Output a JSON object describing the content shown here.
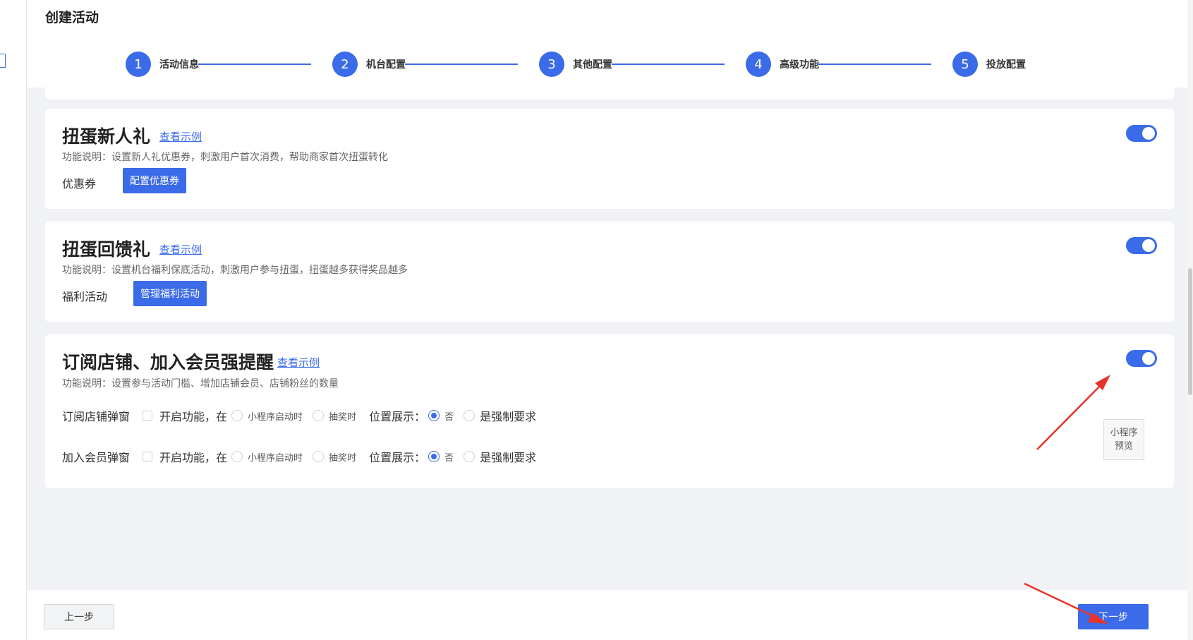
{
  "rail": {
    "icon_glyph": "≡"
  },
  "header": {
    "title": "创建活动"
  },
  "steps": [
    {
      "number": "1",
      "label": "活动信息"
    },
    {
      "number": "2",
      "label": "机台配置"
    },
    {
      "number": "3",
      "label": "其他配置"
    },
    {
      "number": "4",
      "label": "高级功能"
    },
    {
      "number": "5",
      "label": "投放配置"
    }
  ],
  "cards": {
    "newcomer": {
      "title": "扭蛋新人礼",
      "example_link": "查看示例",
      "description": "功能说明：设置新人礼优惠券，刺激用户首次消费，帮助商家首次扭蛋转化",
      "row_label": "优惠券",
      "button": "配置优惠券",
      "enabled": true
    },
    "feedback": {
      "title": "扭蛋回馈礼",
      "example_link": "查看示例",
      "description": "功能说明：设置机台福利保底活动，刺激用户参与扭蛋，扭蛋越多获得奖品越多",
      "row_label": "福利活动",
      "button": "管理福利活动",
      "enabled": true
    },
    "subscribe": {
      "title": "订阅店铺、加入会员强提醒",
      "example_link": "查看示例",
      "description": "功能说明：设置参与活动门槛、增加店铺会员、店铺粉丝的数量",
      "enabled": true,
      "rows": [
        {
          "label": "订阅店铺弹窗",
          "enable_text": "开启功能，在",
          "opt_launch": "小程序启动时",
          "opt_draw": "抽奖时",
          "position_label": "位置展示：",
          "opt_no": "否",
          "opt_force": "是强制要求",
          "selected": "否"
        },
        {
          "label": "加入会员弹窗",
          "enable_text": "开启功能，在",
          "opt_launch": "小程序启动时",
          "opt_draw": "抽奖时",
          "position_label": "位置展示：",
          "opt_no": "否",
          "opt_force": "是强制要求",
          "selected": "否"
        }
      ],
      "preview_line1": "小程序",
      "preview_line2": "预览"
    }
  },
  "footer": {
    "prev": "上一步",
    "next": "下一步"
  },
  "colors": {
    "accent": "#3b6be8",
    "annotation": "#e8332a"
  }
}
